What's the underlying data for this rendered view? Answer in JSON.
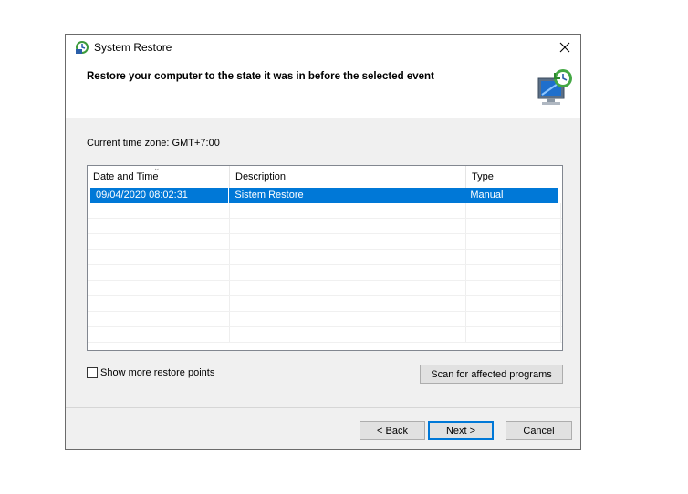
{
  "window": {
    "title": "System Restore",
    "heading": "Restore your computer to the state it was in before the selected event"
  },
  "timezone_label": "Current time zone: GMT+7:00",
  "table": {
    "columns": [
      "Date and Time",
      "Description",
      "Type"
    ],
    "sorted_column": "Date and Time",
    "rows": [
      {
        "date": "09/04/2020 08:02:31",
        "description": "Sistem Restore",
        "type": "Manual",
        "selected": true
      }
    ]
  },
  "show_more_label": "Show more restore points",
  "show_more_checked": false,
  "buttons": {
    "scan": "Scan for affected programs",
    "back": "< Back",
    "next": "Next >",
    "cancel": "Cancel"
  },
  "colors": {
    "selection": "#0078d7",
    "dialog_bg": "#f0f0f0",
    "button_bg": "#e1e1e1"
  },
  "icons": [
    "system-restore-icon",
    "close-icon",
    "computer-restore-icon",
    "sort-arrow-icon"
  ]
}
